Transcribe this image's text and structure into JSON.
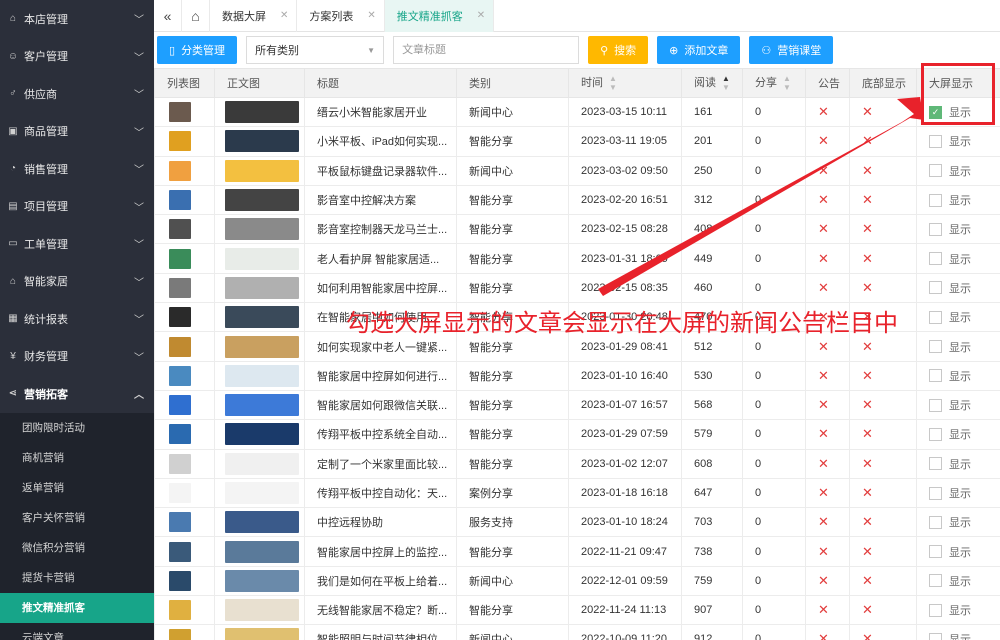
{
  "sidebar": {
    "menus": [
      {
        "label": "本店管理",
        "icon": "home-icon",
        "glyph": "⌂"
      },
      {
        "label": "客户管理",
        "icon": "user-icon",
        "glyph": "☺"
      },
      {
        "label": "供应商",
        "icon": "male-icon",
        "glyph": "♂"
      },
      {
        "label": "商品管理",
        "icon": "gift-icon",
        "glyph": "▣"
      },
      {
        "label": "销售管理",
        "icon": "chart-icon",
        "glyph": "◔"
      },
      {
        "label": "项目管理",
        "icon": "file-icon",
        "glyph": "▤"
      },
      {
        "label": "工单管理",
        "icon": "ticket-icon",
        "glyph": "▭"
      },
      {
        "label": "智能家居",
        "icon": "house-icon",
        "glyph": "⌂"
      },
      {
        "label": "统计报表",
        "icon": "report-icon",
        "glyph": "▦"
      },
      {
        "label": "财务管理",
        "icon": "yen-icon",
        "glyph": "¥"
      },
      {
        "label": "营销拓客",
        "icon": "share-icon",
        "glyph": "⋖"
      }
    ],
    "submenu": [
      {
        "label": "团购限时活动"
      },
      {
        "label": "商机营销"
      },
      {
        "label": "返单营销"
      },
      {
        "label": "客户关怀营销"
      },
      {
        "label": "微信积分营销"
      },
      {
        "label": "提货卡营销"
      },
      {
        "label": "推文精准抓客"
      },
      {
        "label": "云端文章"
      }
    ]
  },
  "tabs": [
    {
      "label": "数据大屏"
    },
    {
      "label": "方案列表"
    },
    {
      "label": "推文精准抓客"
    }
  ],
  "toolbar": {
    "category_button": "分类管理",
    "category_select": "所有类别",
    "search_placeholder": "文章标题",
    "search_button": "搜索",
    "add_button": "添加文章",
    "class_button": "营销课堂"
  },
  "table": {
    "headers": [
      "列表图",
      "正文图",
      "标题",
      "类别",
      "时间",
      "阅读",
      "分享",
      "公告",
      "底部显示",
      "大屏显示"
    ],
    "checkbox_label": "显示",
    "rows": [
      {
        "title": "缙云小米智能家居开业",
        "category": "新闻中心",
        "time": "2023-03-15 10:11",
        "reads": "161",
        "shares": "0",
        "bigscreen": true,
        "c1": "#6b5a4e",
        "c2": "#3a3a3a"
      },
      {
        "title": "小米平板、iPad如何实现...",
        "category": "智能分享",
        "time": "2023-03-11 19:05",
        "reads": "201",
        "shares": "0",
        "bigscreen": false,
        "c1": "#e0a020",
        "c2": "#2b3a4c"
      },
      {
        "title": "平板鼠标键盘记录器软件...",
        "category": "新闻中心",
        "time": "2023-03-02 09:50",
        "reads": "250",
        "shares": "0",
        "bigscreen": false,
        "c1": "#f0a040",
        "c2": "#f3c040"
      },
      {
        "title": "影音室中控解决方案",
        "category": "智能分享",
        "time": "2023-02-20 16:51",
        "reads": "312",
        "shares": "0",
        "bigscreen": false,
        "c1": "#3a6fb0",
        "c2": "#444444"
      },
      {
        "title": "影音室控制器天龙马兰士...",
        "category": "智能分享",
        "time": "2023-02-15 08:28",
        "reads": "408",
        "shares": "0",
        "bigscreen": false,
        "c1": "#505050",
        "c2": "#8a8a8a"
      },
      {
        "title": "老人看护屏 智能家居适...",
        "category": "智能分享",
        "time": "2023-01-31 18:09",
        "reads": "449",
        "shares": "0",
        "bigscreen": false,
        "c1": "#3a8c5a",
        "c2": "#e8ece8"
      },
      {
        "title": "如何利用智能家居中控屏...",
        "category": "智能分享",
        "time": "2023-02-15 08:35",
        "reads": "460",
        "shares": "0",
        "bigscreen": false,
        "c1": "#7a7a7a",
        "c2": "#b0b0b0"
      },
      {
        "title": "在智能家居中如何使用...",
        "category": "智能分享",
        "time": "2023-01-30 20:48",
        "reads": "470",
        "shares": "0",
        "bigscreen": false,
        "c1": "#2a2a2a",
        "c2": "#3a4a5a"
      },
      {
        "title": "如何实现家中老人一键紧...",
        "category": "智能分享",
        "time": "2023-01-29 08:41",
        "reads": "512",
        "shares": "0",
        "bigscreen": false,
        "c1": "#c08a30",
        "c2": "#c9a060"
      },
      {
        "title": "智能家居中控屏如何进行...",
        "category": "智能分享",
        "time": "2023-01-10 16:40",
        "reads": "530",
        "shares": "0",
        "bigscreen": false,
        "c1": "#4a8ac0",
        "c2": "#dde8f0"
      },
      {
        "title": "智能家居如何跟微信关联...",
        "category": "智能分享",
        "time": "2023-01-07 16:57",
        "reads": "568",
        "shares": "0",
        "bigscreen": false,
        "c1": "#2f6fd0",
        "c2": "#3d7ad8"
      },
      {
        "title": "传翔平板中控系统全自动...",
        "category": "智能分享",
        "time": "2023-01-29 07:59",
        "reads": "579",
        "shares": "0",
        "bigscreen": false,
        "c1": "#2a6ab0",
        "c2": "#1a3a6a"
      },
      {
        "title": "定制了一个米家里面比较...",
        "category": "智能分享",
        "time": "2023-01-02 12:07",
        "reads": "608",
        "shares": "0",
        "bigscreen": false,
        "c1": "#d0d0d0",
        "c2": "#f0f0f0"
      },
      {
        "title": "传翔平板中控自动化：天...",
        "category": "案例分享",
        "time": "2023-01-18 16:18",
        "reads": "647",
        "shares": "0",
        "bigscreen": false,
        "c1": "#f4f4f4",
        "c2": "#f4f4f4"
      },
      {
        "title": "中控远程协助",
        "category": "服务支持",
        "time": "2023-01-10 18:24",
        "reads": "703",
        "shares": "0",
        "bigscreen": false,
        "c1": "#4a7ab0",
        "c2": "#3a5a8a"
      },
      {
        "title": "智能家居中控屏上的监控...",
        "category": "智能分享",
        "time": "2022-11-21 09:47",
        "reads": "738",
        "shares": "0",
        "bigscreen": false,
        "c1": "#3a5a7a",
        "c2": "#5a7a9a"
      },
      {
        "title": "我们是如何在平板上给着...",
        "category": "新闻中心",
        "time": "2022-12-01 09:59",
        "reads": "759",
        "shares": "0",
        "bigscreen": false,
        "c1": "#2a4a6a",
        "c2": "#6a8aaa"
      },
      {
        "title": "无线智能家居不稳定？断...",
        "category": "智能分享",
        "time": "2022-11-24 11:13",
        "reads": "907",
        "shares": "0",
        "bigscreen": false,
        "c1": "#e0b040",
        "c2": "#e8e0d0"
      },
      {
        "title": "智能照明与时间节律相位",
        "category": "新闻中心",
        "time": "2022-10-09 11:20",
        "reads": "912",
        "shares": "0",
        "bigscreen": false,
        "c1": "#d0a030",
        "c2": "#e0c070"
      }
    ]
  },
  "annotation": {
    "text": "勾选大屏显示的文章会显示在大屏的新闻公告栏目中",
    "color": "#e8222b"
  },
  "colors": {
    "sidebar_bg": "#2b2f3a",
    "active_green": "#17a589",
    "button_blue": "#1e9fff",
    "button_orange": "#ffb800",
    "x_red": "#e23d3d"
  }
}
